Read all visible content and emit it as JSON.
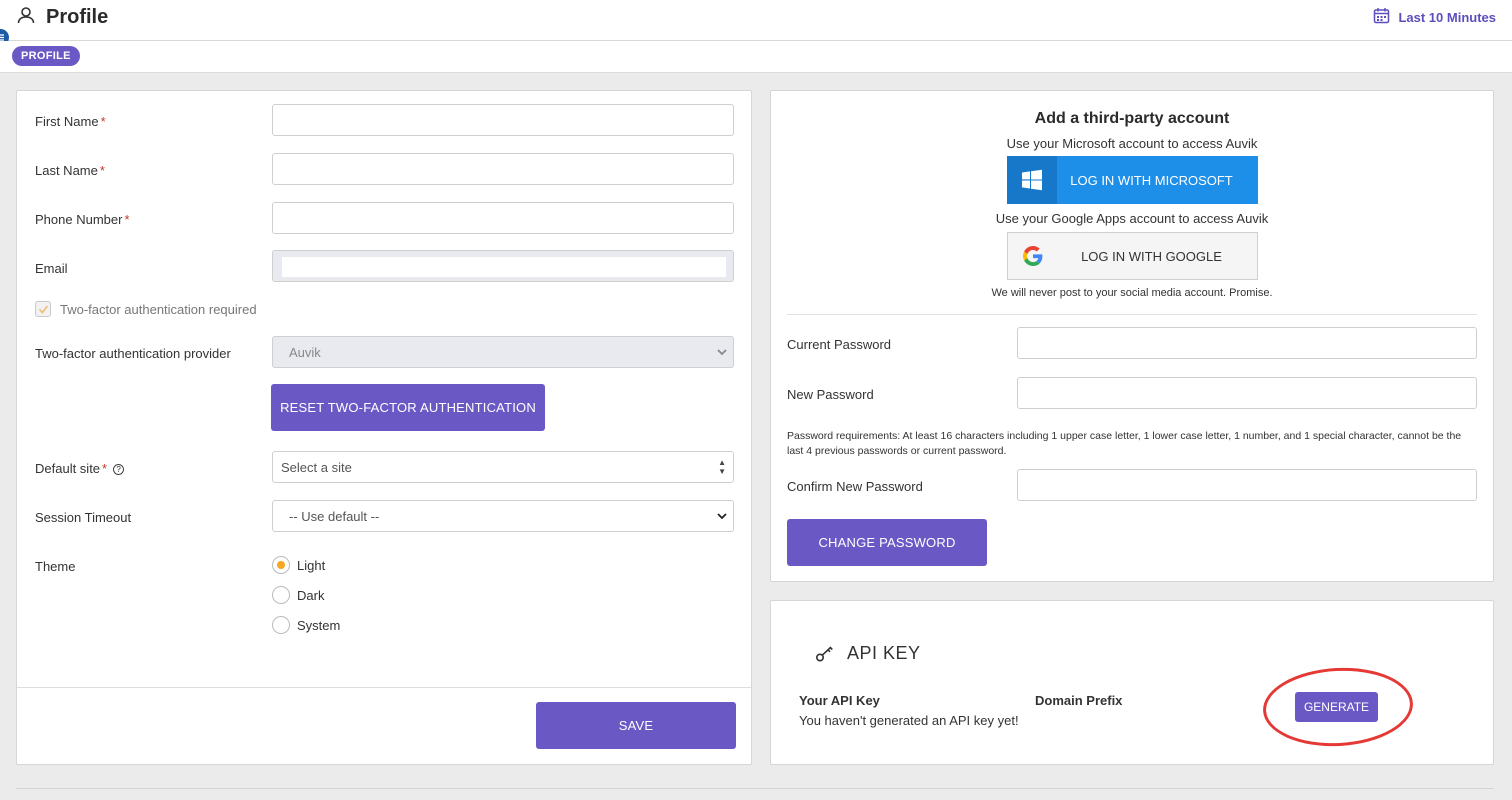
{
  "header": {
    "title": "Profile",
    "time_range": "Last 10 Minutes",
    "breadcrumb_pill": "PROFILE"
  },
  "profile_form": {
    "first_name_label": "First Name",
    "last_name_label": "Last Name",
    "phone_label": "Phone Number",
    "email_label": "Email",
    "required_mark": "*",
    "two_factor_checkbox_label": "Two-factor authentication required",
    "two_factor_required": true,
    "two_factor_provider_label": "Two-factor authentication provider",
    "two_factor_provider_value": "Auvik",
    "reset_two_factor_button": "RESET TWO-FACTOR AUTHENTICATION",
    "default_site_label": "Default site",
    "default_site_placeholder": "Select a site",
    "help_glyph": "?",
    "session_timeout_label": "Session Timeout",
    "session_timeout_value": "-- Use default --",
    "theme_label": "Theme",
    "theme_options": [
      "Light",
      "Dark",
      "System"
    ],
    "theme_selected": "Light",
    "save_button": "SAVE"
  },
  "third_party": {
    "title": "Add a third-party account",
    "microsoft_caption": "Use your Microsoft account to access Auvik",
    "microsoft_button": "LOG IN WITH MICROSOFT",
    "google_caption": "Use your Google Apps account to access Auvik",
    "google_button": "LOG IN WITH GOOGLE",
    "note": "We will never post to your social media account. Promise."
  },
  "password": {
    "current_label": "Current Password",
    "new_label": "New Password",
    "requirements": "Password requirements: At least 16 characters including 1 upper case letter, 1 lower case letter, 1 number, and 1 special character, cannot be the last 4 previous passwords or current password.",
    "confirm_label": "Confirm New Password",
    "change_button": "CHANGE PASSWORD"
  },
  "api_key": {
    "title": "API KEY",
    "your_key_label": "Your API Key",
    "your_key_value": "You haven't generated an API key yet!",
    "domain_prefix_label": "Domain Prefix",
    "generate_button": "GENERATE"
  },
  "colors": {
    "accent": "#6a59c5",
    "microsoft_blue": "#1e8fe8",
    "annotation_red": "#e53935",
    "radio_selected": "#f5a623"
  }
}
